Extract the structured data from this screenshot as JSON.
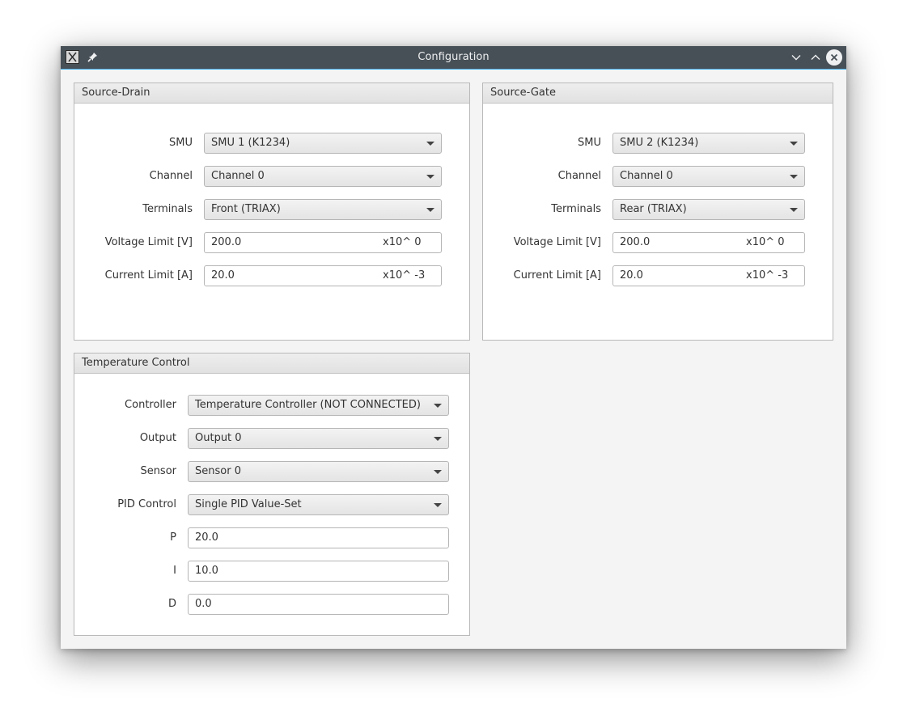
{
  "window": {
    "title": "Configuration"
  },
  "source_drain": {
    "header": "Source-Drain",
    "smu_label": "SMU",
    "smu_value": "SMU 1 (K1234)",
    "channel_label": "Channel",
    "channel_value": "Channel 0",
    "terminals_label": "Terminals",
    "terminals_value": "Front (TRIAX)",
    "voltage_label": "Voltage Limit [V]",
    "voltage_value": "200.0",
    "voltage_unit": "x10^ 0",
    "current_label": "Current Limit [A]",
    "current_value": "20.0",
    "current_unit": "x10^ -3"
  },
  "source_gate": {
    "header": "Source-Gate",
    "smu_label": "SMU",
    "smu_value": "SMU 2 (K1234)",
    "channel_label": "Channel",
    "channel_value": "Channel 0",
    "terminals_label": "Terminals",
    "terminals_value": "Rear (TRIAX)",
    "voltage_label": "Voltage Limit [V]",
    "voltage_value": "200.0",
    "voltage_unit": "x10^ 0",
    "current_label": "Current Limit [A]",
    "current_value": "20.0",
    "current_unit": "x10^ -3"
  },
  "temperature": {
    "header": "Temperature Control",
    "controller_label": "Controller",
    "controller_value": "Temperature Controller (NOT CONNECTED)",
    "output_label": "Output",
    "output_value": "Output 0",
    "sensor_label": "Sensor",
    "sensor_value": "Sensor 0",
    "pid_label": "PID Control",
    "pid_value": "Single PID Value-Set",
    "p_label": "P",
    "p_value": "20.0",
    "i_label": "I",
    "i_value": "10.0",
    "d_label": "D",
    "d_value": "0.0"
  },
  "colors": {
    "titlebar": "#475057",
    "accent": "#3daee9",
    "panel": "#ffffff"
  }
}
